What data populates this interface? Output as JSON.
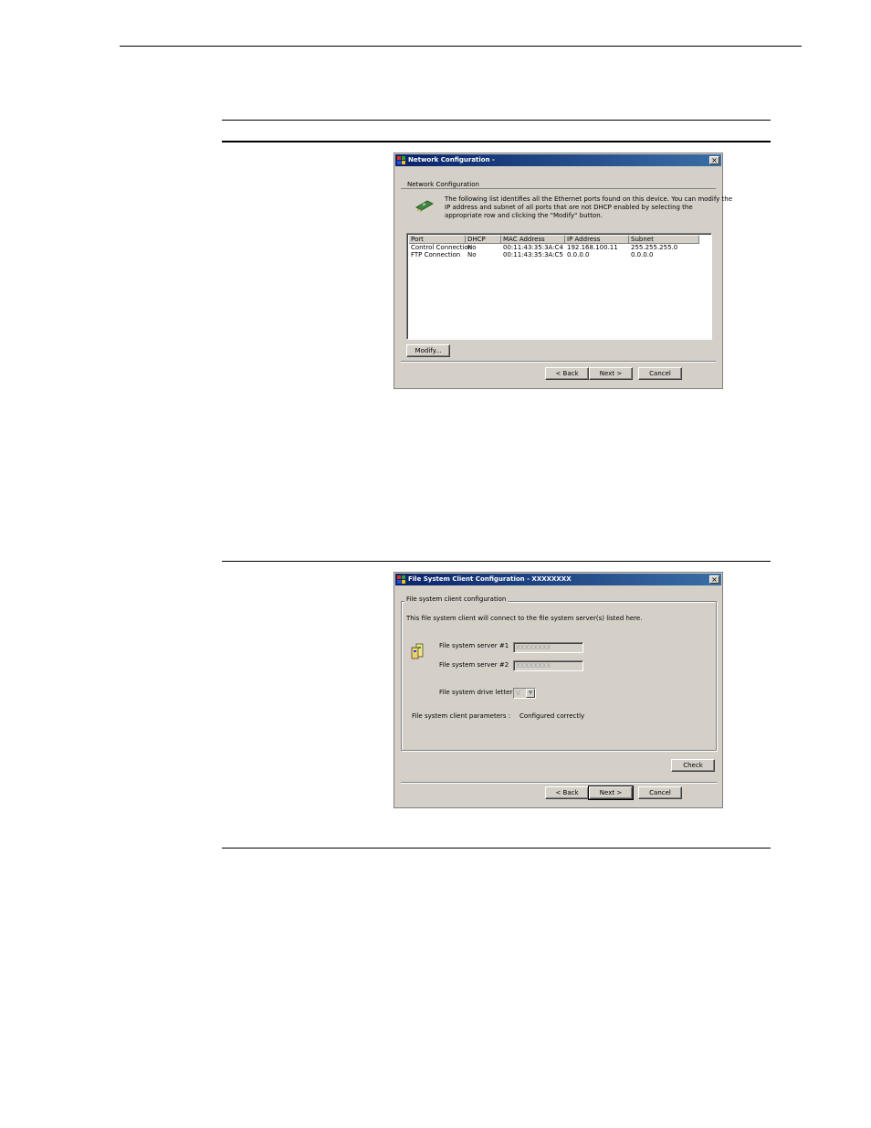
{
  "network_dialog": {
    "title": "Network Configuration -",
    "close_glyph": "×",
    "group_label": "Network Configuration",
    "description_lines": [
      "The following list identifies all the Ethernet ports found on this device. You can modify the",
      "IP address and subnet of all ports that are not DHCP enabled by selecting the",
      "appropriate row and clicking the \"Modify\" button."
    ],
    "columns": [
      "Port",
      "DHCP",
      "MAC Address",
      "IP Address",
      "Subnet"
    ],
    "rows": [
      [
        "Control Connection",
        "No",
        "00:11:43:35:3A:C4",
        "192.168.100.11",
        "255.255.255.0"
      ],
      [
        "FTP Connection",
        "No",
        "00:11:43:35:3A:C5",
        "0.0.0.0",
        "0.0.0.0"
      ]
    ],
    "modify_label": "Modify...",
    "back_label": "< Back",
    "next_label": "Next >",
    "cancel_label": "Cancel"
  },
  "fs_dialog": {
    "title": "File System Client Configuration - XXXXXXXX",
    "close_glyph": "×",
    "group_label": "File system client configuration",
    "description": "This file system client will connect to the file system server(s) listed here.",
    "server1_label": "File system server #1",
    "server1_value": "XXXXXXXX",
    "server2_label": "File system server #2",
    "server2_value": "XXXXXXXX",
    "drive_label": "File system drive letter",
    "drive_value": "V",
    "drive_arrow": "▼",
    "params_label": "File system client parameters :",
    "params_value": "Configured correctly",
    "check_label": "Check",
    "back_label": "< Back",
    "next_label": "Next >",
    "cancel_label": "Cancel"
  },
  "colors": {
    "title_gradient_start": "#0a246a",
    "title_gradient_end": "#3a6ea5",
    "dialog_face": "#d4d0c8"
  }
}
